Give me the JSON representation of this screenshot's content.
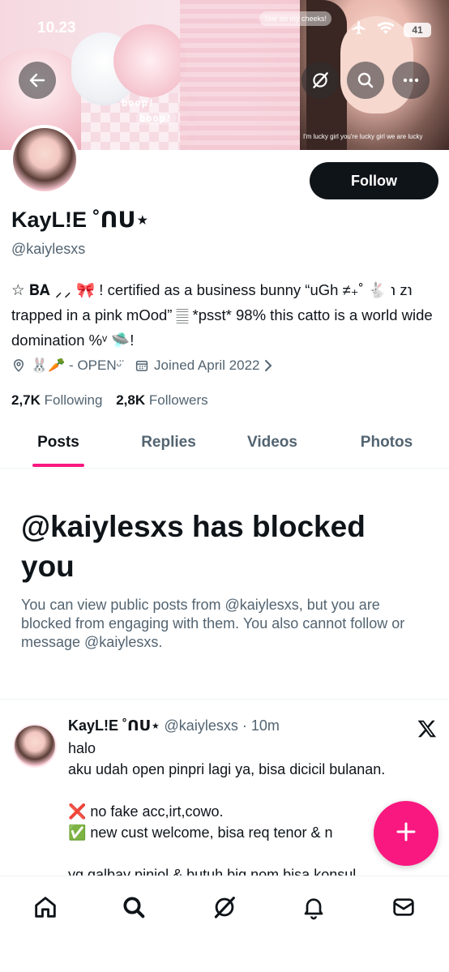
{
  "status_bar": {
    "time": "10.23",
    "battery": "41"
  },
  "banner": {
    "caption_top": "Star on my cheeks!",
    "boop_1": "boop!",
    "boop_2": "boop!",
    "caption_bottom": "I'm lucky girl you're lucky girl we are lucky"
  },
  "profile": {
    "display_name": "KayL!E ˚ᑎᑌ⋆",
    "handle": "@kaiylesxs",
    "follow_label": "Follow",
    "bio": "☆ 𝐁𝐀 ⸝⸝ 🎀 ! certified as a business bunny “uGh ≠₊˚ 🐇 ℩ z℩ trapped in a pink mOod” 𝄛 *psst* 98% this catto is a world wide domination %ᵛ 🛸!",
    "location": "🐰🥕 - OPENᵕ̈",
    "joined": "Joined April 2022",
    "following_count": "2,7K",
    "following_label": "Following",
    "followers_count": "2,8K",
    "followers_label": "Followers"
  },
  "tabs": [
    {
      "label": "Posts"
    },
    {
      "label": "Replies"
    },
    {
      "label": "Videos"
    },
    {
      "label": "Photos"
    }
  ],
  "blocked": {
    "title": "@kaiylesxs has blocked you",
    "description": "You can view public posts from @kaiylesxs, but you are blocked from engaging with them. You also cannot follow or message @kaiylesxs."
  },
  "post": {
    "name": "KayL!E ˚ᑎᑌ⋆",
    "handle_time": "@kaiylesxs · 10m",
    "body": "halo\naku udah open pinpri lagi ya, bisa dicicil bulanan.\n\n❌ no fake acc,irt,cowo.\n✅ new cust welcome, bisa req tenor & n\n\nyg galbay pinjol & butuh big nom bisa konsul"
  },
  "colors": {
    "accent": "#f91880",
    "text": "#0f1419",
    "secondary": "#536471",
    "follow_bg": "#0f1419"
  },
  "icons": {
    "back": "arrow-left-icon",
    "grok": "grok-icon",
    "search": "search-icon",
    "more": "more-icon",
    "location": "location-pin-icon",
    "calendar": "calendar-icon",
    "x_logo": "x-logo-icon",
    "compose": "plus-icon",
    "nav": [
      "home-icon",
      "search-icon",
      "grok-icon",
      "bell-icon",
      "mail-icon"
    ]
  }
}
